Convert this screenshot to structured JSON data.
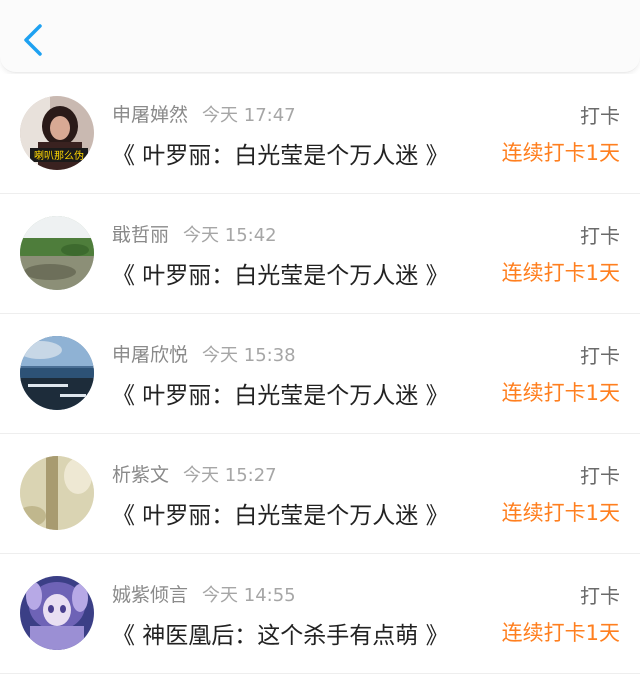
{
  "header": {
    "back_icon": "chevron-left-icon",
    "accent_color": "#1ea1f1"
  },
  "list": [
    {
      "name": "申屠婵然",
      "time": "今天 17:47",
      "book": "《 叶罗丽：白光莹是个万人迷 》",
      "action": "打卡",
      "streak": "连续打卡1天",
      "avatar_caption": "喇叭那么伪"
    },
    {
      "name": "戢哲丽",
      "time": "今天 15:42",
      "book": "《 叶罗丽：白光莹是个万人迷 》",
      "action": "打卡",
      "streak": "连续打卡1天"
    },
    {
      "name": "申屠欣悦",
      "time": "今天 15:38",
      "book": "《 叶罗丽：白光莹是个万人迷 》",
      "action": "打卡",
      "streak": "连续打卡1天"
    },
    {
      "name": "析紫文",
      "time": "今天 15:27",
      "book": "《 叶罗丽：白光莹是个万人迷 》",
      "action": "打卡",
      "streak": "连续打卡1天"
    },
    {
      "name": "娍紫倾言",
      "time": "今天 14:55",
      "book": "《 神医凰后：这个杀手有点萌 》",
      "action": "打卡",
      "streak": "连续打卡1天"
    }
  ]
}
